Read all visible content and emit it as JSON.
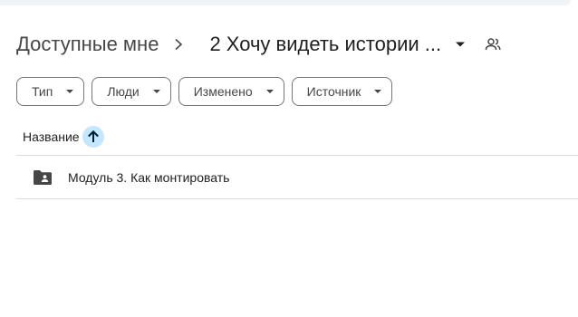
{
  "breadcrumb": {
    "parent": "Доступные мне",
    "current": "2 Хочу видеть истории ..."
  },
  "filters": [
    {
      "label": "Тип"
    },
    {
      "label": "Люди"
    },
    {
      "label": "Изменено"
    },
    {
      "label": "Источник"
    }
  ],
  "table": {
    "header": {
      "name": "Название",
      "sort": "ascending"
    },
    "rows": [
      {
        "name": "Модуль 3. Как монтировать",
        "icon": "shared-folder-icon"
      }
    ]
  },
  "colors": {
    "sort_highlight": "#c2e7ff",
    "divider": "#dadce0",
    "chip_border": "#747775",
    "top_strip": "#f0f4f9"
  }
}
